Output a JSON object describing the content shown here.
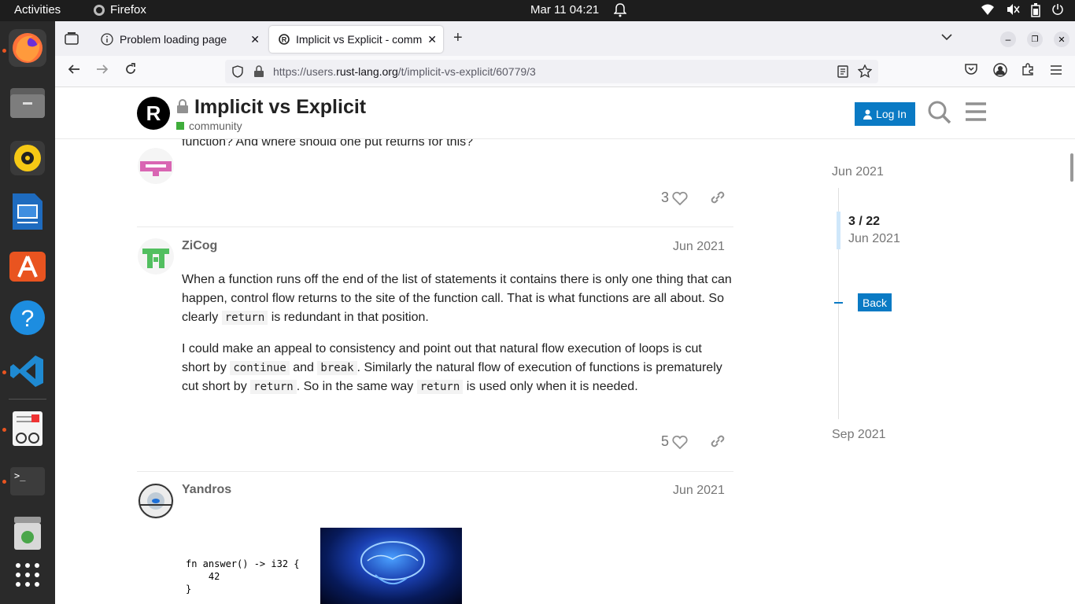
{
  "topbar": {
    "activities": "Activities",
    "app_name": "Firefox",
    "clock": "Mar 11  04:21"
  },
  "browser": {
    "tabs": [
      {
        "label": "Problem loading page"
      },
      {
        "label": "Implicit vs Explicit - comm"
      }
    ],
    "url_prefix": "https://users.",
    "url_domain": "rust-lang.org",
    "url_path": "/t/implicit-vs-explicit/60779/3"
  },
  "header": {
    "title": "Implicit vs Explicit",
    "category": "community",
    "category_color": "#3fad3b",
    "login_label": "Log In"
  },
  "posts": [
    {
      "partial_text": "function? And where should one put returns for this?",
      "likes": "3"
    },
    {
      "username": "ZiCog",
      "date": "Jun 2021",
      "para1_a": "When a function runs off the end of the list of statements it contains there is only one thing that can happen, control flow returns to the site of the function call. That is what functions are all about. So clearly ",
      "para1_code": "return",
      "para1_b": " is redundant in that position.",
      "para2_a": "I could make an appeal to consistency and point out that natural flow execution of loops is cut short by ",
      "para2_code1": "continue",
      "para2_b": " and ",
      "para2_code2": "break",
      "para2_c": ". Similarly the natural flow of execution of functions is prematurely cut short by ",
      "para2_code3": "return",
      "para2_d": ". So in the same way ",
      "para2_code4": "return",
      "para2_e": " is used only when it is needed.",
      "likes": "5"
    },
    {
      "username": "Yandros",
      "date": "Jun 2021",
      "code": "fn answer() -> i32 {\n    42\n}"
    }
  ],
  "timeline": {
    "start_date": "Jun 2021",
    "position": "3 / 22",
    "position_date": "Jun 2021",
    "back_label": "Back",
    "end_date": "Sep 2021"
  },
  "colors": {
    "accent": "#0a7ac4",
    "ubuntu_orange": "#e95420"
  }
}
